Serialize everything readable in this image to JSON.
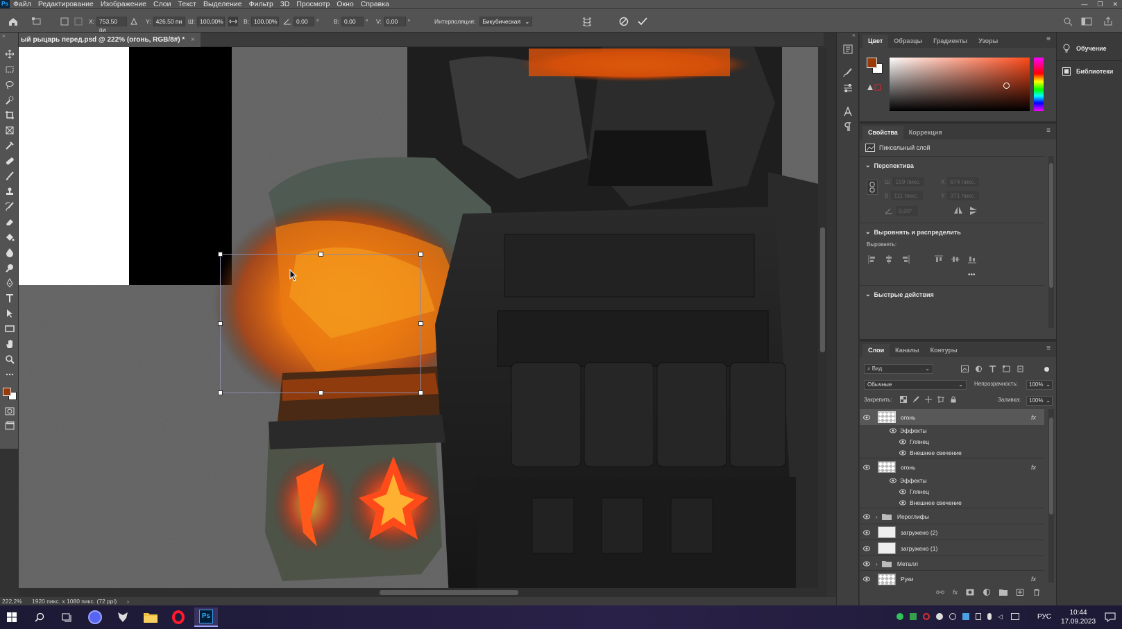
{
  "menubar": {
    "app_logo": "Ps",
    "items": [
      "Файл",
      "Редактирование",
      "Изображение",
      "Слои",
      "Текст",
      "Выделение",
      "Фильтр",
      "3D",
      "Просмотр",
      "Окно",
      "Справка"
    ]
  },
  "options": {
    "x_label": "X:",
    "x_value": "753,50 пи",
    "y_label": "Y:",
    "y_value": "426,50 пи",
    "w_label": "Ш:",
    "w_value": "100,00%",
    "h_label": "В:",
    "h_value": "100,00%",
    "angle_value": "0,00",
    "deg": "°",
    "hskew_label": "В:",
    "hskew_value": "0,00",
    "vskew_label": "V:",
    "vskew_value": "0,00",
    "interp_label": "Интерполяция:",
    "interp_value": "Бикубическая"
  },
  "document": {
    "tab_title": "ый рыцарь перед.psd @ 222% (огонь, RGB/8#) *",
    "tab_close": "×"
  },
  "status": {
    "zoom": "222,2%",
    "info": "1920 пикс. x 1080 пикс. (72 ppi)",
    "arrow": "›"
  },
  "color_panel": {
    "tabs": [
      "Цвет",
      "Образцы",
      "Градиенты",
      "Узоры"
    ],
    "foreground": "#9a3a08",
    "background": "#ffffff",
    "hue_color": "#ff4a1a"
  },
  "properties": {
    "tabs": [
      "Свойства",
      "Коррекция"
    ],
    "layer_type": "Пиксельный слой",
    "perspective": "Перспектива",
    "w_label": "Ш",
    "w_value": "159 пикс.",
    "h_label": "В",
    "h_value": "111 пикс.",
    "x_label": "X",
    "x_value": "674 пикс.",
    "y_label": "Y",
    "y_value": "371 пикс.",
    "angle_value": "0,00°",
    "align_section": "Выровнять и распределить",
    "align_label": "Выровнять:",
    "more": "•••",
    "quick_actions": "Быстрые действия"
  },
  "layers": {
    "tabs": [
      "Слои",
      "Каналы",
      "Контуры"
    ],
    "filter_placeholder": "Вид",
    "blend_mode": "Обычные",
    "opacity_label": "Непрозрачность:",
    "opacity_value": "100%",
    "lock_label": "Закрепить:",
    "fill_label": "Заливка:",
    "fill_value": "100%",
    "fx": "fx",
    "rows": [
      {
        "name": "огонь",
        "kind": "layer"
      },
      {
        "name": "Эффекты",
        "kind": "effects"
      },
      {
        "name": "Глянец",
        "kind": "effect"
      },
      {
        "name": "Внешнее свечение",
        "kind": "effect"
      },
      {
        "name": "огонь",
        "kind": "layer"
      },
      {
        "name": "Эффекты",
        "kind": "effects"
      },
      {
        "name": "Глянец",
        "kind": "effect"
      },
      {
        "name": "Внешнее свечение",
        "kind": "effect"
      },
      {
        "name": "Иероглифы",
        "kind": "group"
      },
      {
        "name": "загружено (2)",
        "kind": "layer"
      },
      {
        "name": "загружено (1)",
        "kind": "layer"
      },
      {
        "name": "Металл",
        "kind": "group"
      },
      {
        "name": "Руки",
        "kind": "layer"
      }
    ]
  },
  "learn_panel": {
    "learn": "Обучение",
    "libraries": "Библиотеки"
  },
  "taskbar": {
    "lang": "РУС",
    "time": "10:44",
    "date": "17.09.2023",
    "ps_label": "Ps"
  }
}
